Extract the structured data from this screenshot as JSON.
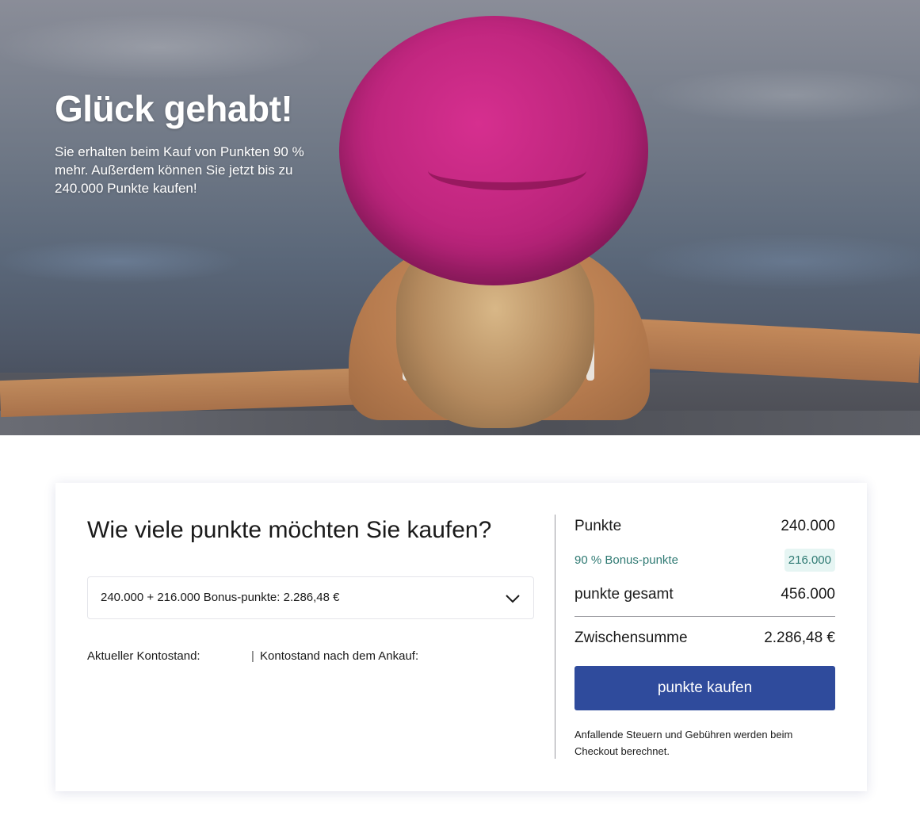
{
  "hero": {
    "title": "Glück gehabt!",
    "text": "Sie erhalten beim Kauf von Punkten 90 % mehr. Außerdem können Sie jetzt bis zu 240.000 Punkte kaufen!"
  },
  "purchase": {
    "heading": "Wie viele punkte möchten Sie kaufen?",
    "selected_option": "240.000 + 216.000 Bonus-punkte: 2.286,48 €",
    "current_balance_label": "Aktueller Kontostand:",
    "separator": "|",
    "balance_after_label": "Kontostand nach dem Ankauf:"
  },
  "summary": {
    "points_label": "Punkte",
    "points_value": "240.000",
    "bonus_label": "90 % Bonus-punkte",
    "bonus_value": "216.000",
    "total_label": "punkte gesamt",
    "total_value": "456.000",
    "subtotal_label": "Zwischensumme",
    "subtotal_value": "2.286,48 €",
    "buy_button_label": "punkte kaufen",
    "note": "Anfallende Steuern und Gebühren werden beim Checkout berechnet."
  },
  "colors": {
    "button": "#2f4b9c",
    "bonus_text": "#2f7a73",
    "bonus_badge_bg": "#e6f5f3"
  },
  "icons": {
    "dropdown": "chevron-down-icon"
  }
}
